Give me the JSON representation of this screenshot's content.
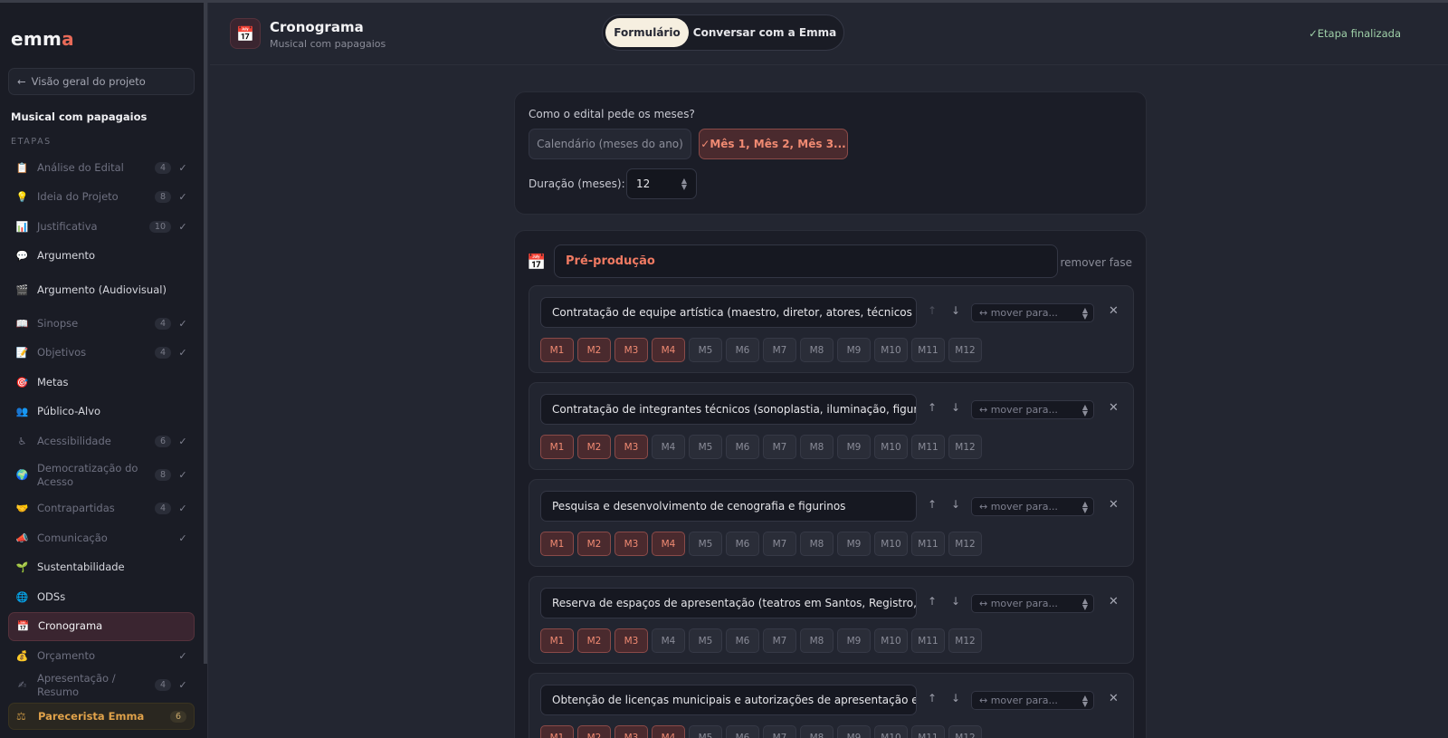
{
  "app": {
    "logo_prefix": "emm",
    "logo_accent": "a"
  },
  "sidebar": {
    "back_label": "Visão geral do projeto",
    "project_name": "Musical com papagaios",
    "section_label": "ETAPAS",
    "items": [
      {
        "icon": "📋",
        "icon_name": "clipboard-icon",
        "label": "Análise do Edital",
        "count": "4",
        "check": "✓"
      },
      {
        "icon": "💡",
        "icon_name": "lightbulb-icon",
        "label": "Ideia do Projeto",
        "count": "8",
        "check": "✓"
      },
      {
        "icon": "📊",
        "icon_name": "bar-chart-icon",
        "label": "Justificativa",
        "count": "10",
        "check": "✓"
      },
      {
        "icon": "💬",
        "icon_name": "speech-bubble-icon",
        "label": "Argumento",
        "count": "",
        "check": ""
      },
      {
        "icon": "🎬",
        "icon_name": "clapperboard-icon",
        "label": "Argumento (Audiovisual)",
        "count": "",
        "check": ""
      },
      {
        "icon": "📖",
        "icon_name": "book-icon",
        "label": "Sinopse",
        "count": "4",
        "check": "✓"
      },
      {
        "icon": "📝",
        "icon_name": "memo-icon",
        "label": "Objetivos",
        "count": "4",
        "check": "✓"
      },
      {
        "icon": "🎯",
        "icon_name": "target-icon",
        "label": "Metas",
        "count": "",
        "check": ""
      },
      {
        "icon": "👥",
        "icon_name": "people-icon",
        "label": "Público-Alvo",
        "count": "",
        "check": ""
      },
      {
        "icon": "♿",
        "icon_name": "accessibility-icon",
        "label": "Acessibilidade",
        "count": "6",
        "check": "✓"
      },
      {
        "icon": "🌍",
        "icon_name": "globe-icon",
        "label": "Democratização do Acesso",
        "count": "8",
        "check": "✓"
      },
      {
        "icon": "🤝",
        "icon_name": "handshake-icon",
        "label": "Contrapartidas",
        "count": "4",
        "check": "✓"
      },
      {
        "icon": "📣",
        "icon_name": "megaphone-icon",
        "label": "Comunicação",
        "count": "",
        "check": "✓"
      },
      {
        "icon": "🌱",
        "icon_name": "seedling-icon",
        "label": "Sustentabilidade",
        "count": "",
        "check": ""
      },
      {
        "icon": "🌐",
        "icon_name": "globe-grid-icon",
        "label": "ODSs",
        "count": "",
        "check": ""
      },
      {
        "icon": "📅",
        "icon_name": "calendar-icon",
        "label": "Cronograma",
        "count": "",
        "check": ""
      },
      {
        "icon": "💰",
        "icon_name": "money-bag-icon",
        "label": "Orçamento",
        "count": "",
        "check": "✓"
      },
      {
        "icon": "✍",
        "icon_name": "writing-hand-icon",
        "label": "Apresentação / Resumo",
        "count": "4",
        "check": "✓"
      }
    ],
    "parecerista": {
      "icon": "⚖",
      "label": "Parecerista Emma",
      "count": "6"
    }
  },
  "header": {
    "icon": "📅",
    "title": "Cronograma",
    "subtitle": "Musical com papagaios",
    "toggle": {
      "form_label": "Formulário",
      "chat_label": "Conversar com a Emma"
    },
    "status": "✓Etapa finalizada"
  },
  "settings": {
    "question": "Como o edital pede os meses?",
    "option_calendar": "Calendário (meses do ano)",
    "option_months": "✓Mês 1, Mês 2, Mês 3...",
    "duration_label": "Duração (meses):",
    "duration_value": "12"
  },
  "phase": {
    "icon": "📅",
    "name": "Pré-produção",
    "remove_label": "remover fase",
    "move_placeholder": "↔ mover para...",
    "month_labels": [
      "M1",
      "M2",
      "M3",
      "M4",
      "M5",
      "M6",
      "M7",
      "M8",
      "M9",
      "M10",
      "M11",
      "M12"
    ],
    "tasks": [
      {
        "text": "Contratação de equipe artística (maestro, diretor, atores, técnicos de som)",
        "selected": [
          1,
          2,
          3,
          4
        ],
        "up_disabled": true
      },
      {
        "text": "Contratação de integrantes técnicos (sonoplastia, iluminação, figurinistas)",
        "selected": [
          1,
          2,
          3
        ],
        "up_disabled": false
      },
      {
        "text": "Pesquisa e desenvolvimento de cenografia e figurinos",
        "selected": [
          1,
          2,
          3,
          4
        ],
        "up_disabled": false
      },
      {
        "text": "Reserva de espaços de apresentação (teatros em Santos, Registro, Cubatão)",
        "selected": [
          1,
          2,
          3
        ],
        "up_disabled": false
      },
      {
        "text": "Obtenção de licenças municipais e autorizações de apresentação em cada cidade",
        "selected": [
          1,
          2,
          3,
          4
        ],
        "up_disabled": false
      }
    ]
  },
  "colors": {
    "accent": "#f07a62",
    "selected_bg": "#4a2a2e",
    "background": "#232631",
    "sidebar": "#1a1c25",
    "success": "#9fd0a8"
  }
}
